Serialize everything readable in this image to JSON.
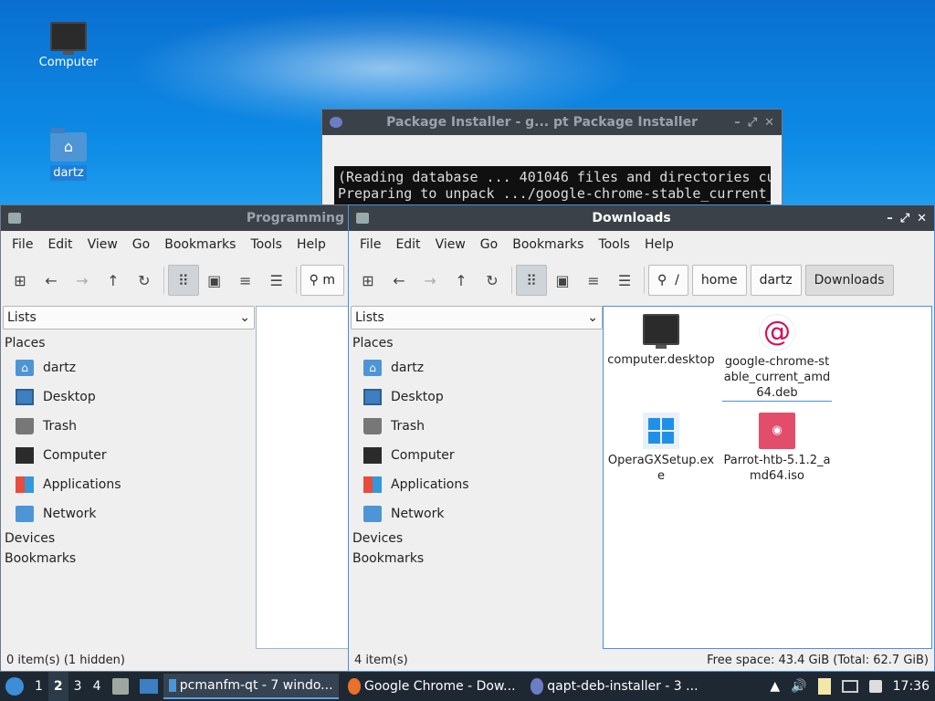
{
  "desktop": {
    "icons": [
      {
        "label": "Computer",
        "icon": "computer-icon"
      },
      {
        "label": "dartz",
        "icon": "home-folder-icon"
      }
    ]
  },
  "installer": {
    "title": "Package Installer - g...  pt Package Installer",
    "log_line1": "(Reading database ... 401046 files and directories cu",
    "log_line2": "Preparing to unpack .../google-chrome-stable_current_"
  },
  "left_window": {
    "title": "Programming",
    "menu": [
      "File",
      "Edit",
      "View",
      "Go",
      "Bookmarks",
      "Tools",
      "Help"
    ],
    "path_partial": "m",
    "status": "0 item(s) (1 hidden)"
  },
  "right_window": {
    "title": "Downloads",
    "menu": [
      "File",
      "Edit",
      "View",
      "Go",
      "Bookmarks",
      "Tools",
      "Help"
    ],
    "breadcrumbs": [
      "/",
      "home",
      "dartz",
      "Downloads"
    ],
    "files": [
      {
        "name": "computer.desktop",
        "icon": "desktop-file-icon"
      },
      {
        "name": "google-chrome-stable_current_amd64.deb",
        "icon": "debian-package-icon"
      },
      {
        "name": "OperaGXSetup.exe",
        "icon": "windows-exe-icon"
      },
      {
        "name": "Parrot-htb-5.1.2_amd64.iso",
        "icon": "disc-image-icon"
      }
    ],
    "status_left": "4 item(s)",
    "status_right": "Free space: 43.4 GiB (Total: 62.7 GiB)"
  },
  "sidebar": {
    "combo": "Lists",
    "places_header": "Places",
    "places": [
      "dartz",
      "Desktop",
      "Trash",
      "Computer",
      "Applications",
      "Network"
    ],
    "devices_header": "Devices",
    "bookmarks_header": "Bookmarks"
  },
  "taskbar": {
    "workspaces": [
      "1",
      "2",
      "3",
      "4"
    ],
    "active_workspace": "2",
    "tasks": [
      {
        "label": "pcmanfm-qt - 7 windo...",
        "icon": "folder-icon"
      },
      {
        "label": "Google Chrome - Dow...",
        "icon": "chrome-icon"
      },
      {
        "label": "qapt-deb-installer - 3 ...",
        "icon": "installer-icon"
      }
    ],
    "clock": "17:36"
  }
}
